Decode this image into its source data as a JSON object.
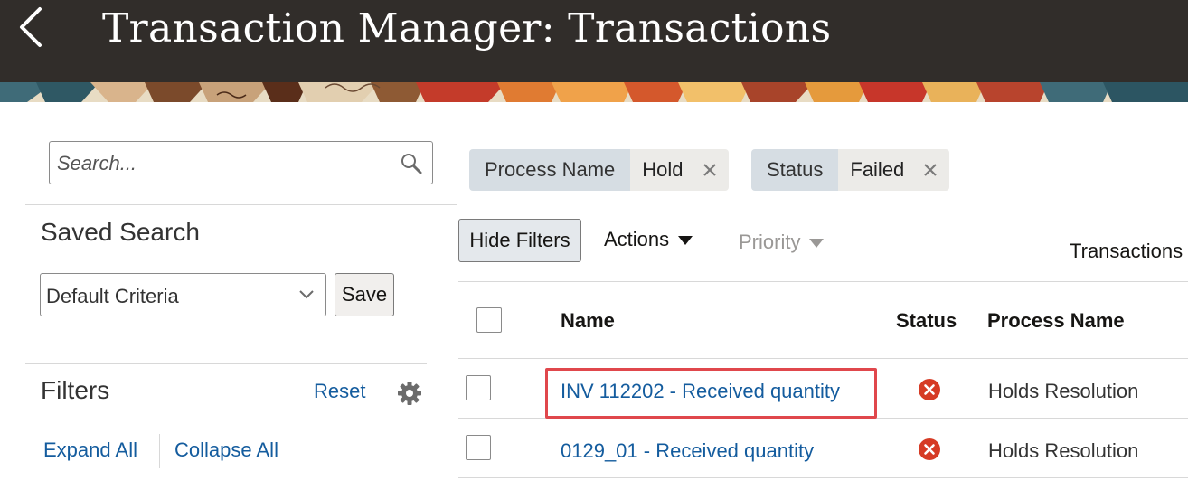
{
  "header": {
    "title": "Transaction Manager: Transactions"
  },
  "search": {
    "placeholder": "Search..."
  },
  "saved_search": {
    "label": "Saved Search",
    "selected": "Default Criteria",
    "save_label": "Save"
  },
  "filters_panel": {
    "label": "Filters",
    "reset_label": "Reset",
    "expand_all_label": "Expand All",
    "collapse_all_label": "Collapse All"
  },
  "applied_filters": [
    {
      "name": "Process Name",
      "value": "Hold"
    },
    {
      "name": "Status",
      "value": "Failed"
    }
  ],
  "toolbar": {
    "hide_filters_label": "Hide Filters",
    "actions_label": "Actions",
    "priority_label": "Priority",
    "view_label": "Transactions"
  },
  "table": {
    "columns": {
      "name": "Name",
      "status": "Status",
      "process": "Process Name"
    },
    "rows": [
      {
        "name": "INV 112202 - Received quantity",
        "status": "error",
        "process": "Holds Resolution"
      },
      {
        "name": "0129_01 - Received quantity",
        "status": "error",
        "process": "Holds Resolution"
      }
    ]
  },
  "colors": {
    "header_bg": "#312d2a",
    "link": "#145c9e",
    "error": "#d63b25",
    "highlight": "#e0474c",
    "chip_label_bg": "#d6dde3",
    "chip_value_bg": "#ecebe8"
  },
  "icons": {
    "back": "chevron-left-icon",
    "search": "search-icon",
    "dropdown": "chevron-down-icon",
    "settings": "gear-icon",
    "remove_filter": "close-icon",
    "status_error": "error-circle-icon"
  }
}
